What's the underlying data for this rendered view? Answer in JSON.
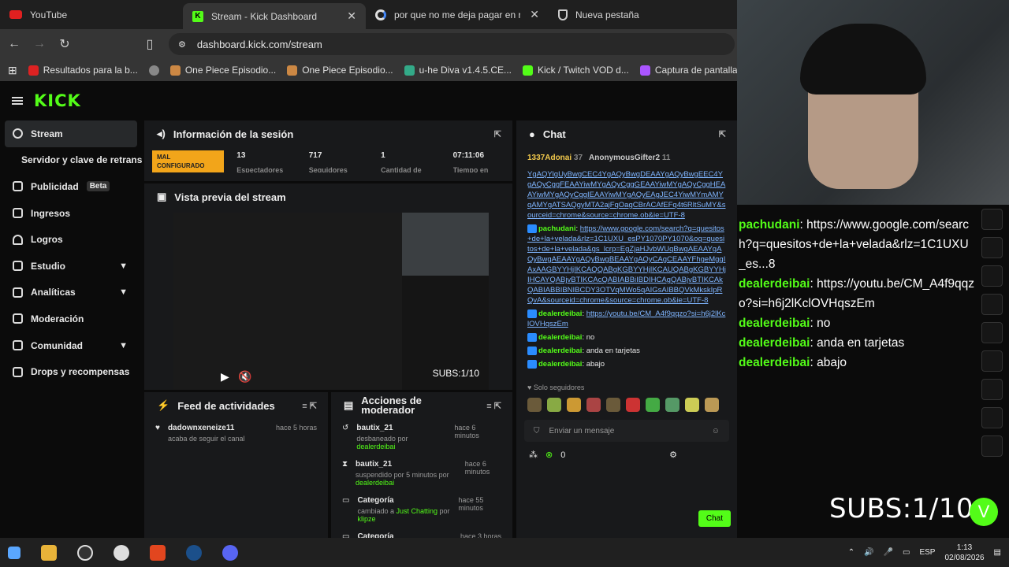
{
  "browser": {
    "tabs": [
      {
        "title": "YouTube"
      },
      {
        "title": "Stream - Kick Dashboard"
      },
      {
        "title": "por que no me deja pagar en ra..."
      },
      {
        "title": "Nueva pestaña"
      }
    ],
    "url": "dashboard.kick.com/stream",
    "bookmarks": [
      {
        "label": "Resultados para la b...",
        "color": "#d22"
      },
      {
        "label": "",
        "color": "#888"
      },
      {
        "label": "One Piece Episodio...",
        "color": "#c84"
      },
      {
        "label": "One Piece Episodio...",
        "color": "#c84"
      },
      {
        "label": "u-he Diva v1.4.5.CE...",
        "color": "#3a8"
      },
      {
        "label": "Kick / Twitch VOD d...",
        "color": "#53fc18"
      },
      {
        "label": "Captura de pantalla...",
        "color": "#a5f"
      }
    ]
  },
  "kick": {
    "logo": "KICK",
    "sidebar": [
      {
        "label": "Stream",
        "active": true
      },
      {
        "label": "Servidor y clave de retransn",
        "sub": true
      },
      {
        "label": "Publicidad",
        "badge": "Beta"
      },
      {
        "label": "Ingresos"
      },
      {
        "label": "Logros"
      },
      {
        "label": "Estudio",
        "chevron": true
      },
      {
        "label": "Analíticas",
        "chevron": true
      },
      {
        "label": "Moderación"
      },
      {
        "label": "Comunidad",
        "chevron": true
      },
      {
        "label": "Drops y recompensas"
      }
    ],
    "session": {
      "title": "Información de la sesión",
      "badge": "MAL CONFIGURADO",
      "stats": [
        "13",
        "717",
        "1",
        "07:11:06"
      ],
      "stat_labels": [
        "Espectadores",
        "Seguidores",
        "Cantidad de",
        "Tiempo en"
      ]
    },
    "preview": {
      "title": "Vista previa del stream",
      "subs": "SUBS:1/10"
    },
    "feed": {
      "title": "Feed de actividades",
      "items": [
        {
          "user": "dadownxeneize11",
          "action": "acaba de seguir el canal",
          "time": "hace 5 horas"
        }
      ]
    },
    "modactions": {
      "title": "Acciones de moderador",
      "items": [
        {
          "user": "bautix_21",
          "action": "desbaneado por",
          "by": "dealerdeibai",
          "time": "hace 6 minutos"
        },
        {
          "user": "bautix_21",
          "action": "suspendido por 5 minutos por",
          "by": "dealerdeibai",
          "time": "hace 6 minutos"
        },
        {
          "user": "Categoría",
          "action": "cambiado a",
          "by": "Just Chatting",
          "by2": "por",
          "by3": "klipze",
          "time": "hace 55 minutos"
        },
        {
          "user": "Categoría",
          "action": "",
          "by": "",
          "time": "hace 3 horas"
        }
      ]
    },
    "chat": {
      "title": "Chat",
      "top_users": [
        {
          "name": "1337Adonai",
          "count": "37"
        },
        {
          "name": "AnonymousGifter2",
          "count": "11"
        }
      ],
      "first_lines": "YgAQYlgUyBwgCEC4YgAQyBwgDEAAYgAQyBwgEEC4YgAQyCggFEAAYiwMYgAQyCggGEAAYiwMYgAQyCggHEAAYiwMYgAQyCggIEAAYiwMYgAQyEAgJEC4YiwMYmAMYqAMYgATSAQgyMTA2ajFqOagCBrACAfEFq4t6RltSuMY&sourceid=chrome&source=chrome.ob&ie=UTF-8",
      "messages": [
        {
          "user": "pachudani",
          "text": "https://www.google.com/search?q=quesitos+de+la+velada&rlz=1C1UXU_esPY1070PY1070&oq=quesitos+de+la+velada&gs_lcrp=EgZjaHJvbWUqBwgAEAAYgAQyBwgAEAAYgAQyBwgBEAAYgAQyCAgCEAAYFhgeMggIAxAAGBYYHjIKCAQQABgKGBYYHjIKCAUQABgKGBYYHjIHCAYQABjvBTIKCAcQABIABBiIBDIHCAgQABjvBTIKCAkQABIABBIBNIBCDY3OTVqMWo5qAIGsAIBBQVkMkskIpRQvA&sourceid=chrome&source=chrome.ob&ie=UTF-8",
          "link": true
        },
        {
          "user": "dealerdeibai",
          "text": "https://youtu.be/CM_A4f9qqzo?si=h6j2lKclOVHqszEm",
          "link": true
        },
        {
          "user": "dealerdeibai",
          "text": "no"
        },
        {
          "user": "dealerdeibai",
          "text": "anda en tarjetas"
        },
        {
          "user": "dealerdeibai",
          "text": "abajo"
        }
      ],
      "followers_only": "Solo seguidores",
      "placeholder": "Enviar un mensaje",
      "points": "0",
      "send_label": "Chat"
    }
  },
  "overlay": {
    "messages": [
      {
        "user": "pachudani",
        "text": "https://www.google.com/search?q=quesitos+de+la+velada&rlz=1C1UXU_es...8"
      },
      {
        "user": "dealerdeibai",
        "text": "https://youtu.be/CM_A4f9qqzo?si=h6j2lKclOVHqszEm"
      },
      {
        "user": "dealerdeibai",
        "text": "no"
      },
      {
        "user": "dealerdeibai",
        "text": "anda en tarjetas"
      },
      {
        "user": "dealerdeibai",
        "text": "abajo"
      }
    ],
    "subs": "SUBS:1/10"
  },
  "taskbar": {
    "lang": "ESP",
    "time": "1:13",
    "date": "02/08/2026"
  }
}
